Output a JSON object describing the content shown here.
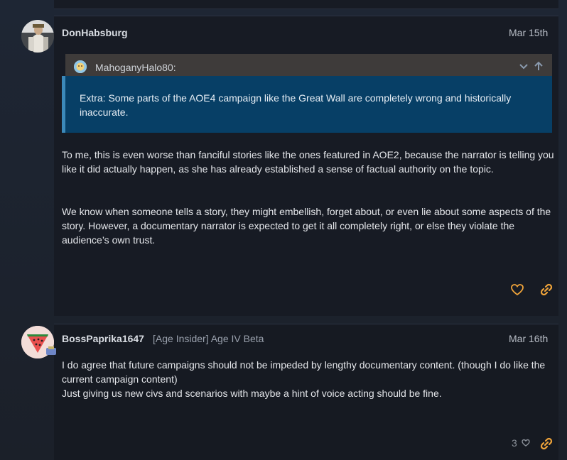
{
  "post1": {
    "username": "DonHabsburg",
    "date": "Mar 15th",
    "quote": {
      "author": "MahoganyHalo80:",
      "text": "Extra: Some parts of the AOE4 campaign like the Great Wall are completely wrong and historically inaccurate."
    },
    "paragraphs": [
      "To me, this is even worse than fanciful stories like the ones featured in AOE2, because the narrator is telling you like it did actually happen, as she has already established a sense of factual authority on the topic.",
      "We know when someone tells a story, they might embellish, forget about, or even lie about some aspects of the story. However, a documentary narrator is expected to get it all completely right, or else they violate the audience’s own trust."
    ],
    "icons": {
      "like": "heart-icon",
      "link": "link-icon"
    }
  },
  "post2": {
    "username": "BossPaprika1647",
    "badge": "[Age Insider] Age IV Beta",
    "date": "Mar 16th",
    "paragraphs": [
      "I do agree that future campaigns should not be impeded by lengthy documentary content. (though I do like the current campaign content)",
      "Just giving us new civs and scenarios with maybe a hint of voice acting should be fine."
    ],
    "likes": "3",
    "icons": {
      "like": "heart-icon",
      "link": "link-icon"
    }
  },
  "colors": {
    "accent": "#f0a43a",
    "quote_bg": "#073f66",
    "quote_border": "#3c89b9"
  }
}
